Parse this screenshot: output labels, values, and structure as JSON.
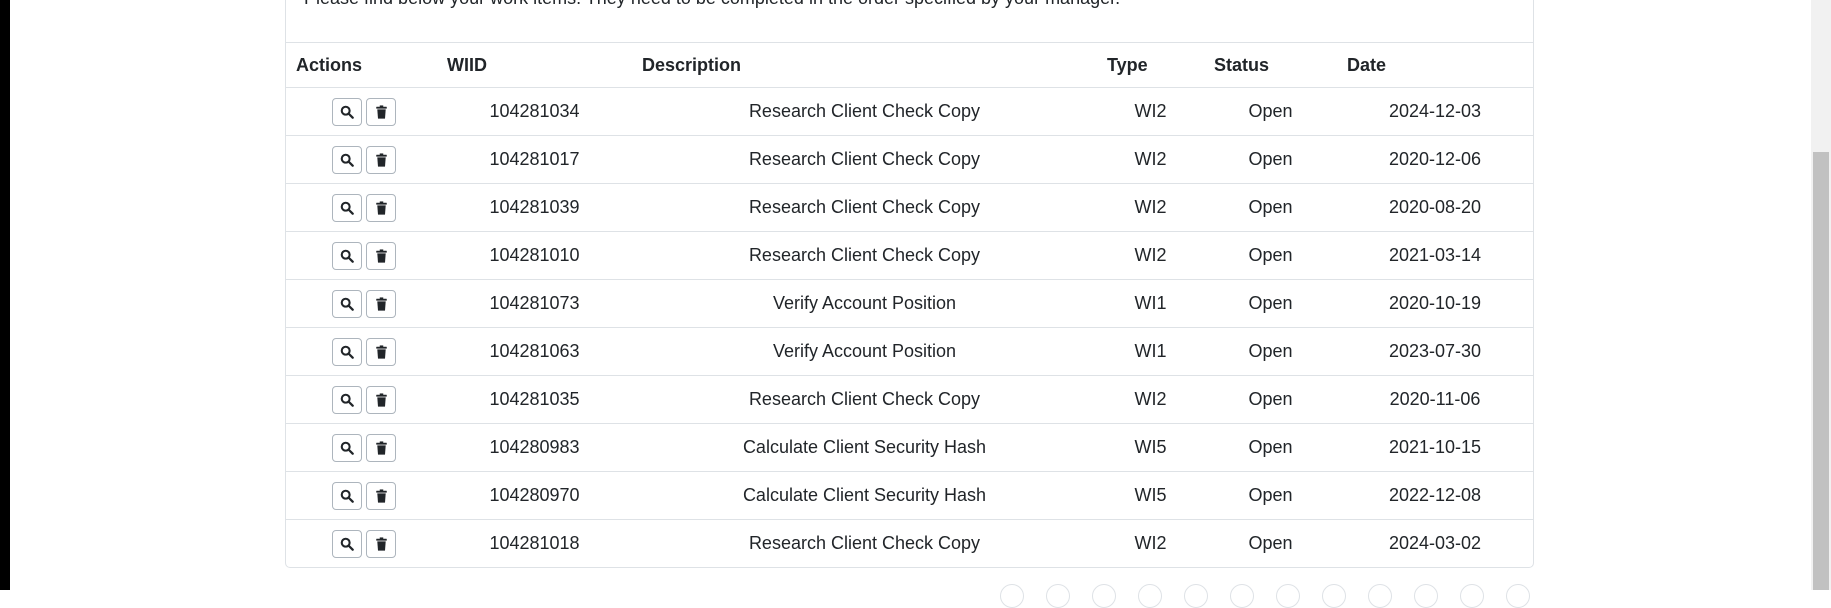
{
  "intro_text": "Please find below your work items. They need to be completed in the order specified by your manager.",
  "table": {
    "headers": {
      "actions": "Actions",
      "wiid": "WIID",
      "description": "Description",
      "type": "Type",
      "status": "Status",
      "date": "Date"
    },
    "rows": [
      {
        "wiid": "104281034",
        "description": "Research Client Check Copy",
        "type": "WI2",
        "status": "Open",
        "date": "2024-12-03"
      },
      {
        "wiid": "104281017",
        "description": "Research Client Check Copy",
        "type": "WI2",
        "status": "Open",
        "date": "2020-12-06"
      },
      {
        "wiid": "104281039",
        "description": "Research Client Check Copy",
        "type": "WI2",
        "status": "Open",
        "date": "2020-08-20"
      },
      {
        "wiid": "104281010",
        "description": "Research Client Check Copy",
        "type": "WI2",
        "status": "Open",
        "date": "2021-03-14"
      },
      {
        "wiid": "104281073",
        "description": "Verify Account Position",
        "type": "WI1",
        "status": "Open",
        "date": "2020-10-19"
      },
      {
        "wiid": "104281063",
        "description": "Verify Account Position",
        "type": "WI1",
        "status": "Open",
        "date": "2023-07-30"
      },
      {
        "wiid": "104281035",
        "description": "Research Client Check Copy",
        "type": "WI2",
        "status": "Open",
        "date": "2020-11-06"
      },
      {
        "wiid": "104280983",
        "description": "Calculate Client Security Hash",
        "type": "WI5",
        "status": "Open",
        "date": "2021-10-15"
      },
      {
        "wiid": "104280970",
        "description": "Calculate Client Security Hash",
        "type": "WI5",
        "status": "Open",
        "date": "2022-12-08"
      },
      {
        "wiid": "104281018",
        "description": "Research Client Check Copy",
        "type": "WI2",
        "status": "Open",
        "date": "2024-03-02"
      }
    ],
    "row_action_icons": [
      "search-icon",
      "trash-icon"
    ]
  },
  "pagination": {
    "visible_page_buttons": 12
  }
}
